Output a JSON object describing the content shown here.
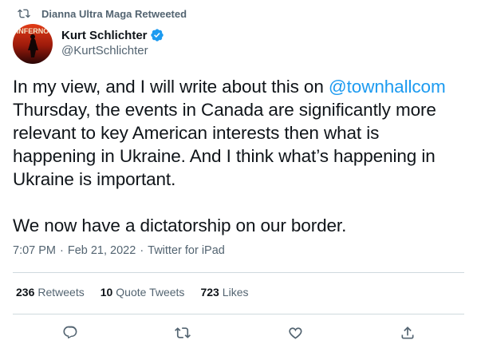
{
  "retweet_context": {
    "text": "Dianna Ultra Maga Retweeted",
    "icon": "retweet-icon"
  },
  "author": {
    "name": "Kurt Schlichter",
    "handle": "@KurtSchlichter",
    "verified": true,
    "avatar_text": "INFERNO",
    "avatar_colors": {
      "top": "#e23b16",
      "bottom": "#2a0606"
    }
  },
  "tweet": {
    "line1_prefix": "In my view, and I will write about this on ",
    "mention": "@townhallcom",
    "line2": "Thursday, the events in Canada are significantly more",
    "line3": "relevant to key American interests then what is",
    "line4": "happening in Ukraine. And I think what’s happening in",
    "line5": "Ukraine is important.",
    "line6": "We now have a dictatorship on our border."
  },
  "meta": {
    "time": "7:07 PM",
    "date": "Feb 21, 2022",
    "source": "Twitter for iPad",
    "separator": "·"
  },
  "stats": {
    "retweets_count": "236",
    "retweets_label": "Retweets",
    "quotes_count": "10",
    "quotes_label": "Quote Tweets",
    "likes_count": "723",
    "likes_label": "Likes"
  },
  "actions": [
    "reply-icon",
    "retweet-icon",
    "like-icon",
    "share-icon"
  ],
  "colors": {
    "text": "#0f1419",
    "secondary": "#536471",
    "link": "#1d9bf0",
    "divider": "#cfd9de",
    "verified": "#1d9bf0"
  }
}
